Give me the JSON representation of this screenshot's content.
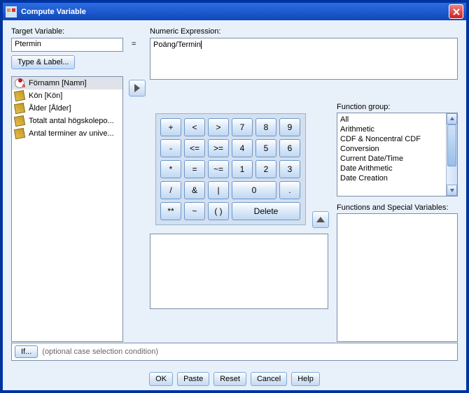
{
  "title": "Compute Variable",
  "labels": {
    "target_variable": "Target Variable:",
    "numeric_expression": "Numeric Expression:",
    "type_label_btn": "Type & Label...",
    "function_group": "Function group:",
    "functions_special": "Functions and Special Variables:",
    "if_btn": "If...",
    "if_desc": "(optional case selection condition)",
    "equals": "="
  },
  "target_value": "Ptermin",
  "expression_value": "Poäng/Termin",
  "variables": [
    {
      "icon": "nom",
      "label": "Förnamn [Namn]",
      "selected": true
    },
    {
      "icon": "ruler",
      "label": "Kön [Kön]",
      "selected": false
    },
    {
      "icon": "ruler",
      "label": "Ålder [Ålder]",
      "selected": false
    },
    {
      "icon": "ruler",
      "label": "Totalt antal högskolepo...",
      "selected": false
    },
    {
      "icon": "ruler",
      "label": "Antal terminer av unive...",
      "selected": false
    }
  ],
  "keypad": [
    [
      "+",
      "<",
      ">",
      "7",
      "8",
      "9"
    ],
    [
      "-",
      "<=",
      ">=",
      "4",
      "5",
      "6"
    ],
    [
      "*",
      "=",
      "~=",
      "1",
      "2",
      "3"
    ],
    [
      "/",
      "&",
      "|",
      "0_wide",
      "."
    ],
    [
      "**",
      "~",
      "( )",
      "Delete_del"
    ]
  ],
  "function_groups": [
    "All",
    "Arithmetic",
    "CDF & Noncentral CDF",
    "Conversion",
    "Current Date/Time",
    "Date Arithmetic",
    "Date Creation"
  ],
  "bottom": {
    "ok": "OK",
    "paste": "Paste",
    "reset": "Reset",
    "cancel": "Cancel",
    "help": "Help"
  }
}
